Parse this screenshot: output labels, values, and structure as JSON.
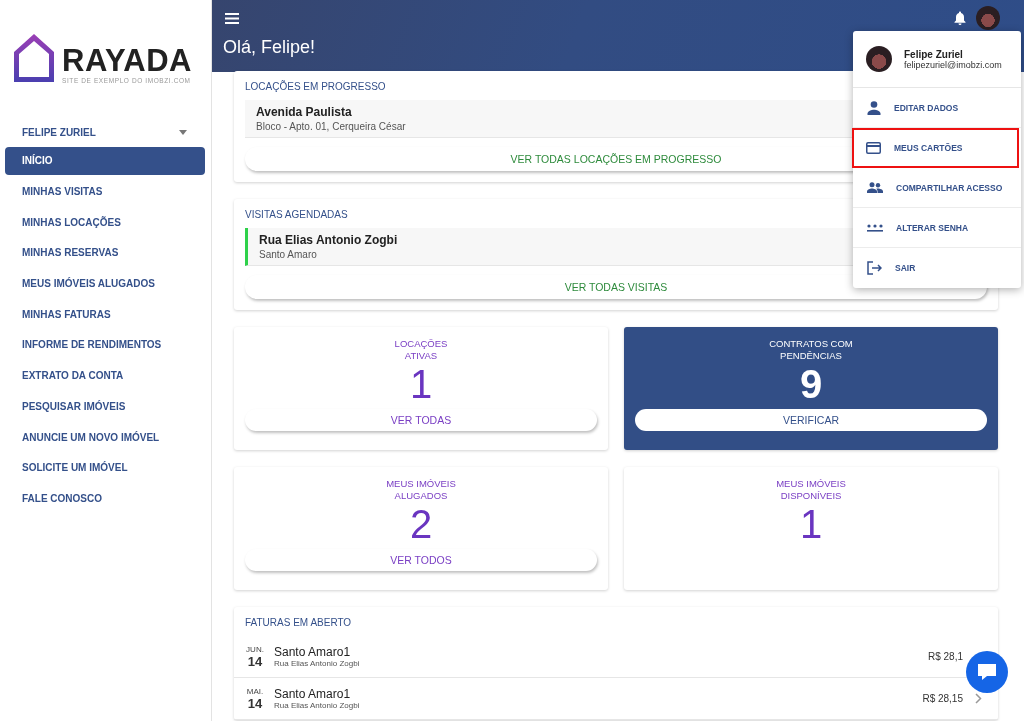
{
  "logo": {
    "name": "RAYADA",
    "tagline": "SITE DE EXEMPLO DO IMOBZI.COM"
  },
  "sidebar": {
    "user": "FELIPE ZURIEL",
    "items": [
      {
        "label": "INÍCIO",
        "selected": true
      },
      {
        "label": "MINHAS VISITAS",
        "selected": false
      },
      {
        "label": "MINHAS LOCAÇÕES",
        "selected": false
      },
      {
        "label": "MINHAS RESERVAS",
        "selected": false
      },
      {
        "label": "MEUS IMÓVEIS ALUGADOS",
        "selected": false
      },
      {
        "label": "MINHAS FATURAS",
        "selected": false
      },
      {
        "label": "INFORME DE RENDIMENTOS",
        "selected": false
      },
      {
        "label": "EXTRATO DA CONTA",
        "selected": false
      },
      {
        "label": "PESQUISAR IMÓVEIS",
        "selected": false
      },
      {
        "label": "ANUNCIE UM NOVO IMÓVEL",
        "selected": false
      },
      {
        "label": "SOLICITE UM IMÓVEL",
        "selected": false
      },
      {
        "label": "FALE CONOSCO",
        "selected": false
      }
    ]
  },
  "header": {
    "greeting": "Olá, Felipe!"
  },
  "lists": [
    {
      "title": "LOCAÇÕES EM PROGRESSO",
      "item": {
        "title": "Avenida Paulista",
        "subtitle": "Bloco - Apto. 01, Cerqueira César",
        "accent": false
      },
      "button": "VER TODAS LOCAÇÕES EM PROGRESSO"
    },
    {
      "title": "VISITAS AGENDADAS",
      "item": {
        "title": "Rua Elias Antonio Zogbi",
        "subtitle": "Santo Amaro",
        "accent": true
      },
      "button": "VER TODAS VISITAS"
    }
  ],
  "stats": [
    {
      "label": "LOCAÇÕES\nATIVAS",
      "value": "1",
      "button": "VER TODAS",
      "highlighted": false
    },
    {
      "label": "CONTRATOS COM\nPENDÊNCIAS",
      "value": "9",
      "button": "VERIFICAR",
      "highlighted": true
    },
    {
      "label": "MEUS IMÓVEIS\nALUGADOS",
      "value": "2",
      "button": "VER TODOS",
      "highlighted": false
    },
    {
      "label": "MEUS IMÓVEIS\nDISPONÍVEIS",
      "value": "1",
      "highlighted": false
    }
  ],
  "invoices": {
    "title": "FATURAS EM ABERTO",
    "rows": [
      {
        "month": "JUN.",
        "day": "14",
        "title": "Santo Amaro1",
        "address": "Rua Elias Antonio Zogbi",
        "amount": "R$ 28,1",
        "chevron": false
      },
      {
        "month": "MAI.",
        "day": "14",
        "title": "Santo Amaro1",
        "address": "Rua Elias Antonio Zogbi",
        "amount": "R$ 28,15",
        "chevron": true
      }
    ]
  },
  "user_menu": {
    "name": "Felipe Zuriel",
    "email": "felipezuriel@imobzi.com",
    "items": [
      {
        "kind": "person",
        "label": "EDITAR DADOS",
        "highlighted": false
      },
      {
        "kind": "card",
        "label": "MEUS CARTÕES",
        "highlighted": true
      },
      {
        "kind": "people",
        "label": "COMPARTILHAR ACESSO",
        "highlighted": false
      },
      {
        "kind": "password",
        "label": "ALTERAR SENHA",
        "highlighted": false
      },
      {
        "kind": "exit",
        "label": "SAIR",
        "highlighted": false
      }
    ]
  }
}
